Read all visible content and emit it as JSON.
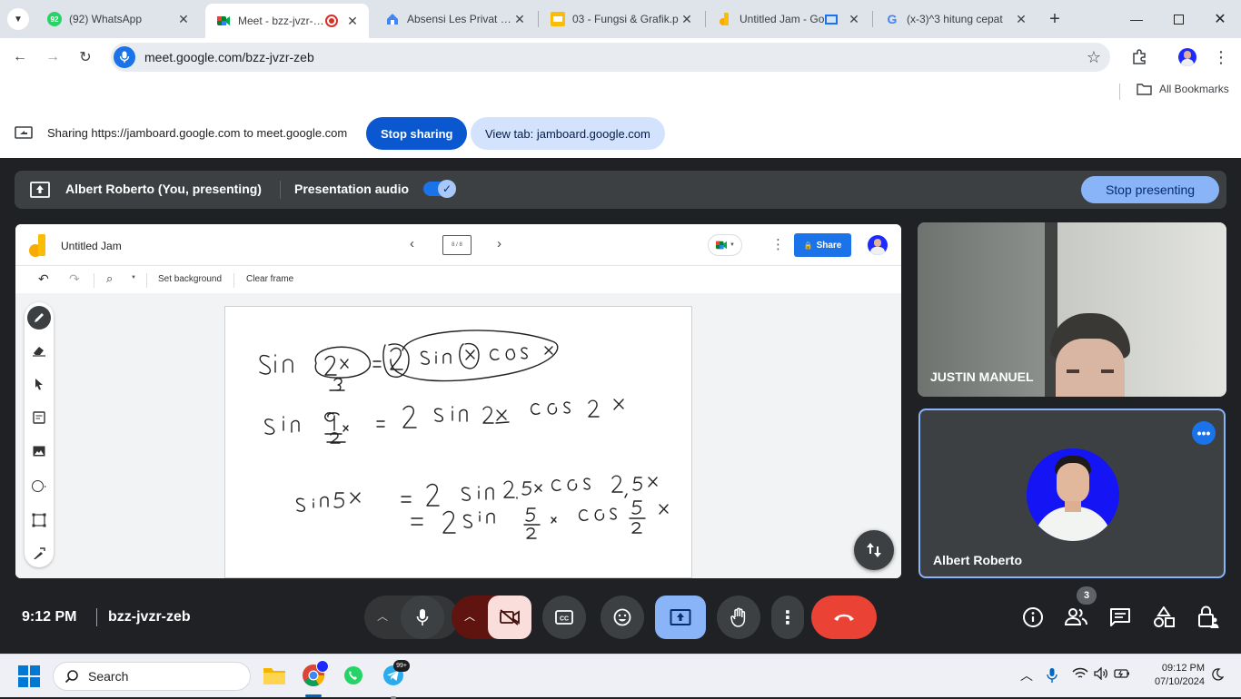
{
  "browser": {
    "tabs": [
      {
        "title": "(92) WhatsApp",
        "badge": "92"
      },
      {
        "title": "Meet - bzz-jvzr-zeb"
      },
      {
        "title": "Absensi Les Privat – S"
      },
      {
        "title": "03 - Fungsi & Grafik.p"
      },
      {
        "title": "Untitled Jam - Go"
      },
      {
        "title": "(x-3)^3 hitung cepat"
      }
    ],
    "url": "meet.google.com/bzz-jvzr-zeb",
    "bookmarks_label": "All Bookmarks"
  },
  "share_bar": {
    "message": "Sharing https://jamboard.google.com to meet.google.com",
    "stop_sharing": "Stop sharing",
    "view_tab": "View tab: jamboard.google.com"
  },
  "presenting_bar": {
    "presenter": "Albert Roberto (You, presenting)",
    "audio_label": "Presentation audio",
    "stop_presenting": "Stop presenting"
  },
  "jamboard": {
    "title": "Untitled Jam",
    "frame_indicator": "8 / 8",
    "share_label": "Share",
    "toolbar": {
      "set_background": "Set background",
      "clear_frame": "Clear frame"
    },
    "handwriting": [
      "sin(2x) = 2 sin(x) cos x",
      "sin 9/2 x = 2 sin 2x cos 2 x",
      "sin 5x = 2 sin 2.5x cos 2,5x",
      "= 2 sin 5/2 x cos 5/2 x"
    ]
  },
  "participants": [
    {
      "name": "JUSTIN MANUEL"
    },
    {
      "name": "Albert Roberto"
    }
  ],
  "meeting": {
    "time": "9:12 PM",
    "code": "bzz-jvzr-zeb",
    "people_count": "3"
  },
  "taskbar": {
    "search_label": "Search",
    "telegram_badge": "99+",
    "clock_time": "09:12 PM",
    "clock_date": "07/10/2024"
  },
  "colors": {
    "accent": "#1a73e8",
    "end_call": "#ea4335",
    "stop_sharing": "#0b57d0",
    "present_active": "#8ab4f8"
  }
}
